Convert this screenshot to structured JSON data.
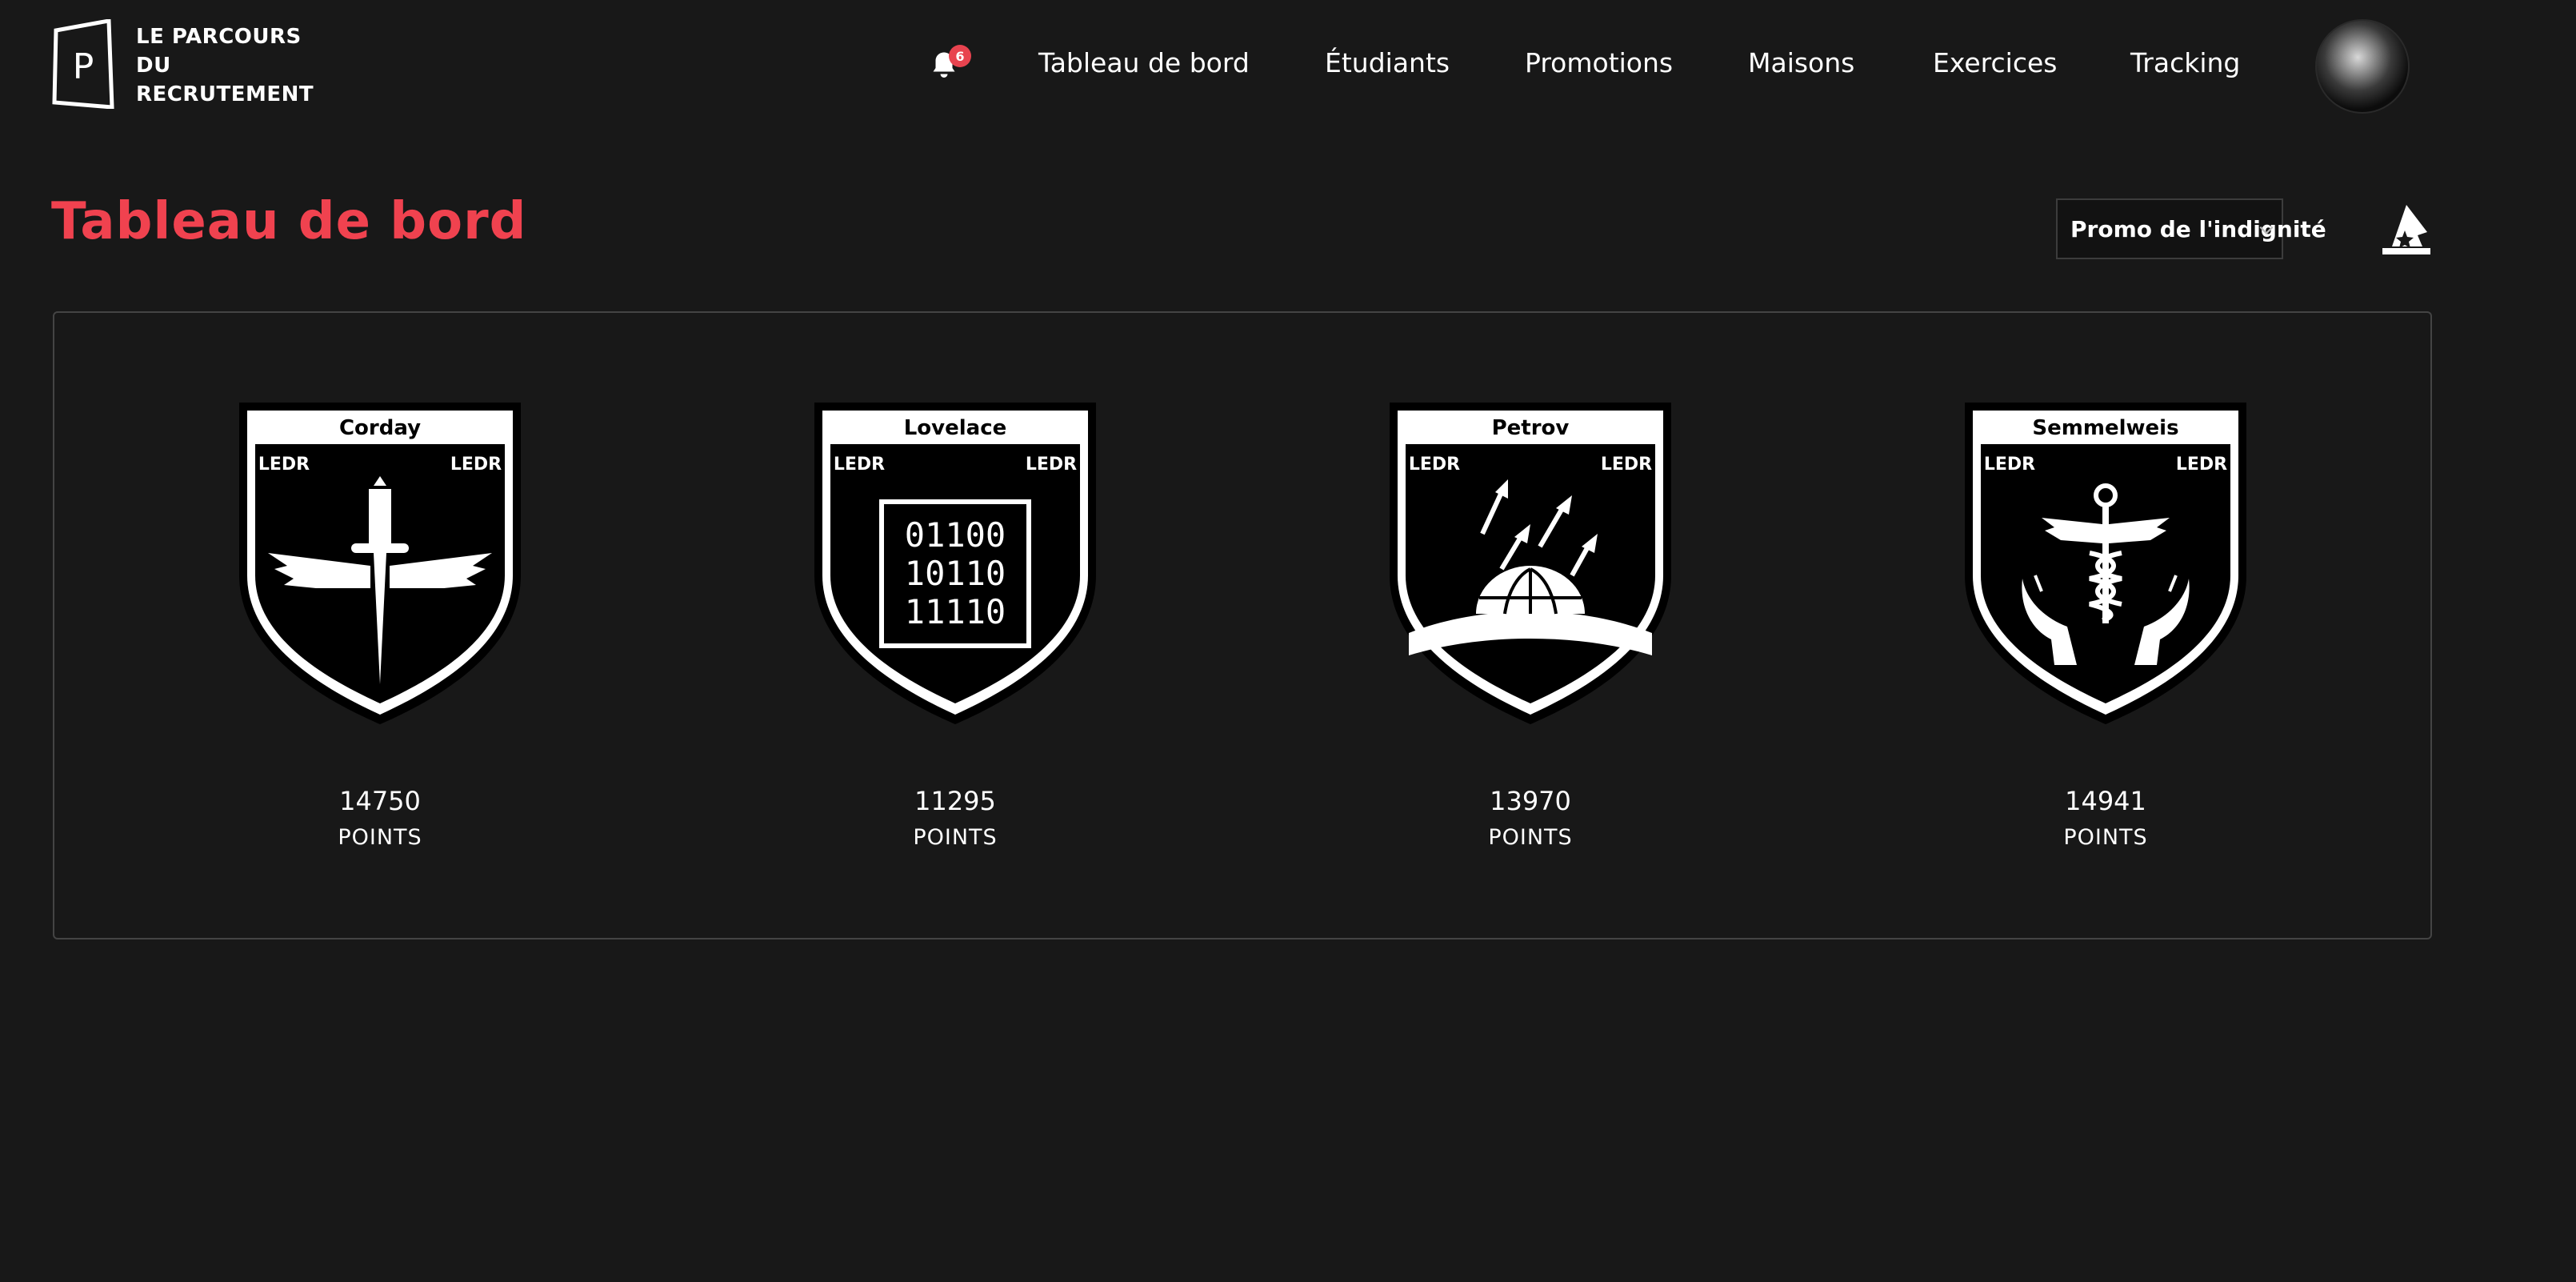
{
  "brand": {
    "lines": [
      "LE PARCOURS",
      "DU",
      "RECRUTEMENT"
    ],
    "logo_letter": "P"
  },
  "notifications": {
    "count": "6"
  },
  "nav": {
    "items": [
      {
        "label": "Tableau de bord"
      },
      {
        "label": "Étudiants"
      },
      {
        "label": "Promotions"
      },
      {
        "label": "Maisons"
      },
      {
        "label": "Exercices"
      },
      {
        "label": "Tracking"
      }
    ]
  },
  "page": {
    "title": "Tableau de bord"
  },
  "promo_select": {
    "selected": "Promo de l'indignité"
  },
  "houses": [
    {
      "name": "Corday",
      "tag_left": "LEDR",
      "tag_right": "LEDR",
      "points": "14750",
      "points_label": "POINTS",
      "emblem": "dagger-wings-icon"
    },
    {
      "name": "Lovelace",
      "tag_left": "LEDR",
      "tag_right": "LEDR",
      "points": "11295",
      "points_label": "POINTS",
      "emblem": "binary-icon",
      "binary": [
        "01100",
        "10110",
        "11110"
      ]
    },
    {
      "name": "Petrov",
      "tag_left": "LEDR",
      "tag_right": "LEDR",
      "points": "13970",
      "points_label": "POINTS",
      "emblem": "missiles-dome-icon"
    },
    {
      "name": "Semmelweis",
      "tag_left": "LEDR",
      "tag_right": "LEDR",
      "points": "14941",
      "points_label": "POINTS",
      "emblem": "caduceus-hands-icon"
    }
  ],
  "colors": {
    "background": "#181818",
    "accent": "#f0424f",
    "badge": "#e8434f",
    "panel_border": "#444444"
  }
}
